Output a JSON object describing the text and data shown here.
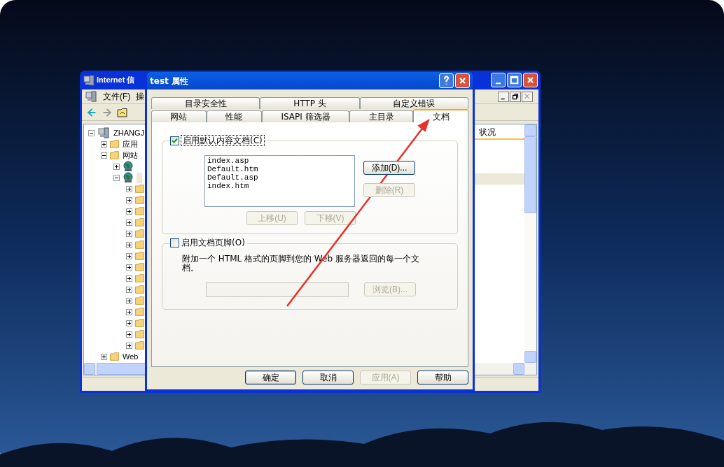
{
  "back_window": {
    "title": "Internet 信",
    "menu": [
      "文件(F)",
      "操"
    ],
    "tree": [
      {
        "kind": "server",
        "label": "ZHANGJ",
        "expanded": true,
        "selected": false,
        "children": [
          {
            "kind": "folder",
            "label": "应用",
            "expanded": false,
            "selected": false
          },
          {
            "kind": "folder",
            "label": "网站",
            "expanded": true,
            "selected": false,
            "children": [
              {
                "kind": "site",
                "expanded": false
              },
              {
                "kind": "site",
                "expanded": true,
                "selected": true,
                "children": [
                  {
                    "kind": "folder",
                    "expanded": false
                  },
                  {
                    "kind": "folder",
                    "expanded": false
                  },
                  {
                    "kind": "folder",
                    "expanded": false
                  },
                  {
                    "kind": "folder",
                    "expanded": false
                  },
                  {
                    "kind": "folder",
                    "expanded": false
                  },
                  {
                    "kind": "folder",
                    "expanded": false
                  },
                  {
                    "kind": "folder",
                    "expanded": false
                  },
                  {
                    "kind": "folder",
                    "expanded": false
                  },
                  {
                    "kind": "folder",
                    "expanded": false
                  },
                  {
                    "kind": "folder",
                    "expanded": false
                  },
                  {
                    "kind": "folder",
                    "expanded": false
                  },
                  {
                    "kind": "folder",
                    "expanded": false
                  },
                  {
                    "kind": "folder",
                    "expanded": false
                  },
                  {
                    "kind": "folder",
                    "expanded": false
                  },
                  {
                    "kind": "folder",
                    "expanded": false
                  }
                ]
              }
            ]
          },
          {
            "kind": "folder",
            "label": "Web",
            "expanded": false,
            "selected": false
          }
        ]
      }
    ],
    "list_header": "状况",
    "list_rows": [
      {
        "selected": false
      },
      {
        "selected": false
      },
      {
        "selected": false
      },
      {
        "selected": true
      }
    ]
  },
  "dialog": {
    "title": "test 属性",
    "tab_rows": [
      {
        "tabs": [
          {
            "label": "目录安全性",
            "selected": false
          },
          {
            "label": "HTTP 头",
            "selected": false
          },
          {
            "label": "自定义错误",
            "selected": false
          }
        ]
      },
      {
        "tabs": [
          {
            "label": "网站",
            "selected": false
          },
          {
            "label": "性能",
            "selected": false
          },
          {
            "label": "ISAPI 筛选器",
            "selected": false
          },
          {
            "label": "主目录",
            "selected": false
          },
          {
            "label": "文档",
            "selected": true
          }
        ]
      }
    ],
    "default_docs": {
      "label": "启用默认内容文档(C)",
      "checked": true,
      "items": [
        "index.asp",
        "Default.htm",
        "Default.asp",
        "index.htm"
      ],
      "add_button": {
        "label": "添加(D)...",
        "disabled": false
      },
      "remove_button": {
        "label": "删除(R)",
        "disabled": true
      },
      "move_up_button": {
        "label": "上移(U)",
        "disabled": true
      },
      "move_down_button": {
        "label": "下移(V)",
        "disabled": true
      }
    },
    "footer": {
      "label": "启用文档页脚(O)",
      "checked": false,
      "description": "附加一个 HTML 格式的页脚到您的 Web 服务器返回的每一个文档。",
      "path_disabled": true,
      "browse_button": {
        "label": "浏览(B)...",
        "disabled": true
      }
    },
    "buttons": [
      {
        "label": "确定",
        "disabled": false,
        "default": true
      },
      {
        "label": "取消",
        "disabled": false,
        "default": false
      },
      {
        "label": "应用(A)",
        "disabled": true,
        "default": false
      },
      {
        "label": "帮助",
        "disabled": false,
        "default": false
      }
    ]
  }
}
